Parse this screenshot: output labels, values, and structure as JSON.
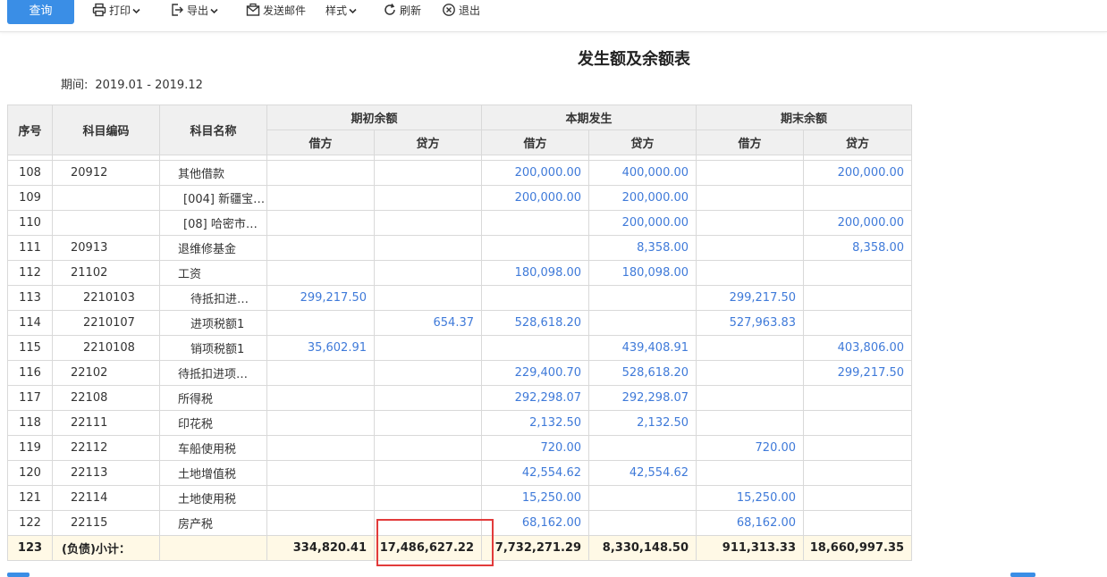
{
  "toolbar": {
    "query": "查询",
    "print": "打印",
    "export": "导出",
    "send_mail": "发送邮件",
    "style": "样式",
    "refresh": "刷新",
    "exit": "退出"
  },
  "report": {
    "title": "发生额及余额表",
    "period_label": "期间:",
    "period_value": "2019.01 - 2019.12"
  },
  "columns": {
    "seq": "序号",
    "code": "科目编码",
    "name": "科目名称",
    "opening": "期初余额",
    "current": "本期发生",
    "closing": "期末余额",
    "debit": "借方",
    "credit": "贷方"
  },
  "rows": [
    {
      "seq": "108",
      "code": "20912",
      "name": "其他借款",
      "od": "",
      "oc": "",
      "cd": "200,000.00",
      "cc": "400,000.00",
      "ed": "",
      "ec": "200,000.00"
    },
    {
      "seq": "109",
      "code": "",
      "name": "[004] 新疆宝…",
      "od": "",
      "oc": "",
      "cd": "200,000.00",
      "cc": "200,000.00",
      "ed": "",
      "ec": ""
    },
    {
      "seq": "110",
      "code": "",
      "name": "[08] 哈密市…",
      "od": "",
      "oc": "",
      "cd": "",
      "cc": "200,000.00",
      "ed": "",
      "ec": "200,000.00"
    },
    {
      "seq": "111",
      "code": "20913",
      "name": "退维修基金",
      "od": "",
      "oc": "",
      "cd": "",
      "cc": "8,358.00",
      "ed": "",
      "ec": "8,358.00"
    },
    {
      "seq": "112",
      "code": "21102",
      "name": "工资",
      "od": "",
      "oc": "",
      "cd": "180,098.00",
      "cc": "180,098.00",
      "ed": "",
      "ec": ""
    },
    {
      "seq": "113",
      "code": "2210103",
      "name": "待抵扣进…",
      "od": "299,217.50",
      "oc": "",
      "cd": "",
      "cc": "",
      "ed": "299,217.50",
      "ec": ""
    },
    {
      "seq": "114",
      "code": "2210107",
      "name": "进项税额1",
      "od": "",
      "oc": "654.37",
      "cd": "528,618.20",
      "cc": "",
      "ed": "527,963.83",
      "ec": ""
    },
    {
      "seq": "115",
      "code": "2210108",
      "name": "销项税额1",
      "od": "35,602.91",
      "oc": "",
      "cd": "",
      "cc": "439,408.91",
      "ed": "",
      "ec": "403,806.00"
    },
    {
      "seq": "116",
      "code": "22102",
      "name": "待抵扣进项…",
      "od": "",
      "oc": "",
      "cd": "229,400.70",
      "cc": "528,618.20",
      "ed": "",
      "ec": "299,217.50"
    },
    {
      "seq": "117",
      "code": "22108",
      "name": "所得税",
      "od": "",
      "oc": "",
      "cd": "292,298.07",
      "cc": "292,298.07",
      "ed": "",
      "ec": ""
    },
    {
      "seq": "118",
      "code": "22111",
      "name": "印花税",
      "od": "",
      "oc": "",
      "cd": "2,132.50",
      "cc": "2,132.50",
      "ed": "",
      "ec": ""
    },
    {
      "seq": "119",
      "code": "22112",
      "name": "车船使用税",
      "od": "",
      "oc": "",
      "cd": "720.00",
      "cc": "",
      "ed": "720.00",
      "ec": ""
    },
    {
      "seq": "120",
      "code": "22113",
      "name": "土地增值税",
      "od": "",
      "oc": "",
      "cd": "42,554.62",
      "cc": "42,554.62",
      "ed": "",
      "ec": ""
    },
    {
      "seq": "121",
      "code": "22114",
      "name": "土地使用税",
      "od": "",
      "oc": "",
      "cd": "15,250.00",
      "cc": "",
      "ed": "15,250.00",
      "ec": ""
    },
    {
      "seq": "122",
      "code": "22115",
      "name": "房产税",
      "od": "",
      "oc": "",
      "cd": "68,162.00",
      "cc": "",
      "ed": "68,162.00",
      "ec": ""
    }
  ],
  "total": {
    "seq": "123",
    "code": "(负债)小计：",
    "name": "",
    "od": "334,820.41",
    "oc": "17,486,627.22",
    "cd": "7,732,271.29",
    "cc": "8,330,148.50",
    "ed": "911,313.33",
    "ec": "18,660,997.35"
  },
  "colors": {
    "accent": "#3a8ee6",
    "amount": "#3f7ad9",
    "highlight": "#e23b3b",
    "total_bg": "#fff9e6"
  }
}
